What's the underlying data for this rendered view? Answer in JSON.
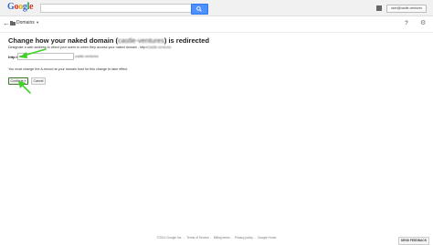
{
  "header": {
    "logo_text": "Google",
    "search": {
      "value": "",
      "placeholder": ""
    },
    "account_label": "user@castle-ventures"
  },
  "subnav": {
    "section_label": "Domains",
    "help_label": "?",
    "settings_label": "⚙"
  },
  "main": {
    "title_prefix": "Change how your naked domain (",
    "title_domain": "castle-ventures",
    "title_suffix": ") is redirected",
    "description": "Designate a web address to direct your users to when they access your naked domain - http://",
    "description_domain": "castle-ventures",
    "http_label": "http://",
    "prefix_value": "www",
    "domain_suffix": ".castle-ventures",
    "notice": "You must change the A-record at your domain host for this change to take effect.",
    "continue_label": "Continue »",
    "cancel_label": "Cancel"
  },
  "footer": {
    "links": [
      "©2014 Google Inc.",
      "Terms of Service",
      "Billing terms",
      "Privacy policy",
      "Google Home"
    ],
    "feedback_label": "SEND FEEDBACK"
  },
  "colors": {
    "search_button": "#4d90fe",
    "annotation_arrow": "#3fd126"
  }
}
